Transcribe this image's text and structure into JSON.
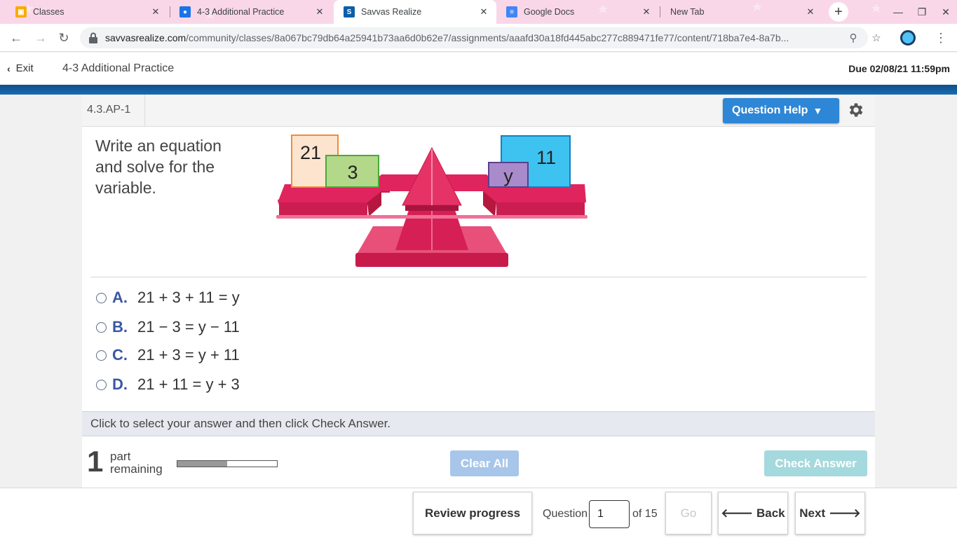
{
  "browser": {
    "tabs": [
      {
        "label": "Classes",
        "favicon": "classroom-icon",
        "color": "#f9ab00"
      },
      {
        "label": "4-3 Additional Practice",
        "favicon": "assignment-icon",
        "color": "#1a73e8"
      },
      {
        "label": "Savvas Realize",
        "favicon": "savvas-icon",
        "color": "#0b5ea8",
        "active": true
      },
      {
        "label": "Google Docs",
        "favicon": "docs-icon",
        "color": "#4285f4"
      },
      {
        "label": "New Tab",
        "favicon": "",
        "color": ""
      }
    ],
    "url_host": "savvasrealize.com",
    "url_path": "/community/classes/8a067bc79db64a25941b73aa6d0b62e7/assignments/aaafd30a18fd445abc277c889471fe77/content/718ba7e4-8a7b..."
  },
  "header": {
    "exit_label": "Exit",
    "assignment_title": "4-3 Additional Practice",
    "due": "Due 02/08/21 11:59pm"
  },
  "question": {
    "id": "4.3.AP-1",
    "help_label": "Question Help",
    "prompt": "Write an equation and solve for the variable.",
    "scale": {
      "left_blocks": [
        "21",
        "3"
      ],
      "right_blocks": [
        "y",
        "11"
      ]
    },
    "choices": [
      {
        "letter": "A.",
        "expr": "21 + 3 + 11 = y"
      },
      {
        "letter": "B.",
        "expr": "21 − 3 = y − 11"
      },
      {
        "letter": "C.",
        "expr": "21 + 3 = y + 11"
      },
      {
        "letter": "D.",
        "expr": "21 + 11 = y + 3"
      }
    ],
    "instruction": "Click to select your answer and then click Check Answer.",
    "parts_count": "1",
    "parts_label_1": "part",
    "parts_label_2": "remaining",
    "progress_fraction": 0.5,
    "clear_label": "Clear All",
    "check_label": "Check Answer"
  },
  "footer": {
    "review_label": "Review progress",
    "question_label": "Question",
    "question_value": "1",
    "of_label": "of 15",
    "go_label": "Go",
    "back_label": "Back",
    "next_label": "Next"
  },
  "colors": {
    "accent": "#2e86d6",
    "scale_pink": "#e0245e",
    "band": "#0e4f8a"
  }
}
